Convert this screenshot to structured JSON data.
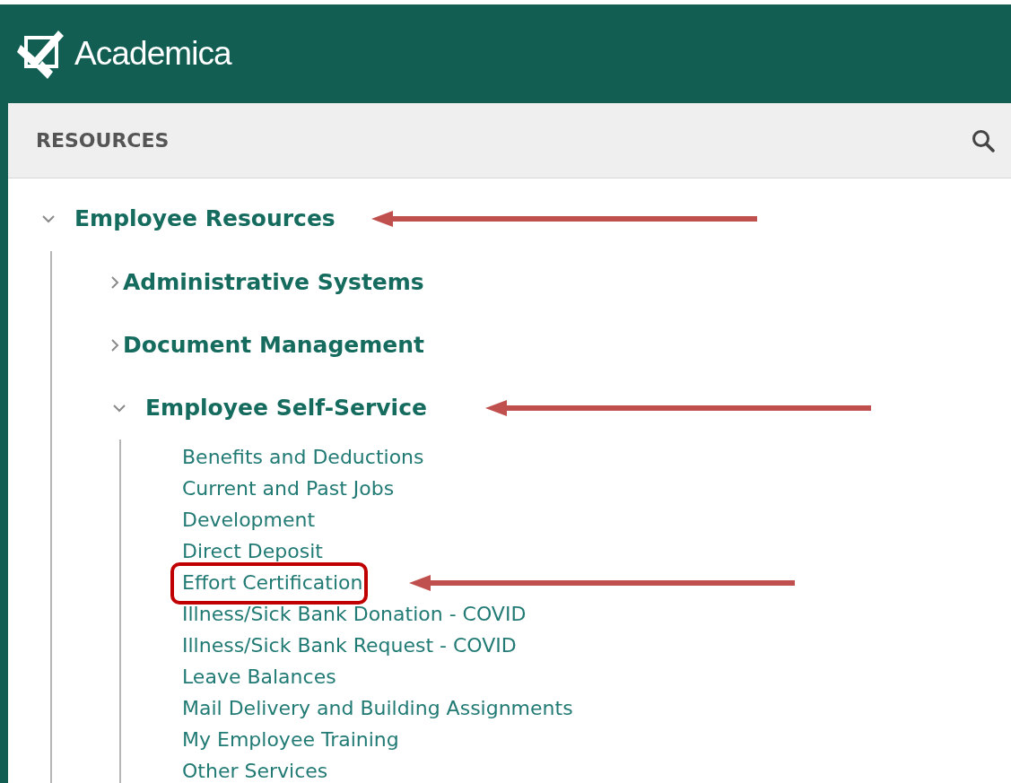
{
  "header": {
    "logo_text": "Academica"
  },
  "panel": {
    "title": "RESOURCES"
  },
  "tree": [
    {
      "label": "Employee Resources",
      "expanded": true,
      "arrow": true,
      "children": [
        {
          "label": "Administrative Systems",
          "expanded": false,
          "arrow": false
        },
        {
          "label": "Document Management",
          "expanded": false,
          "arrow": false
        },
        {
          "label": "Employee Self-Service",
          "expanded": true,
          "arrow": true,
          "children": [
            {
              "label": "Benefits and Deductions",
              "arrow": false,
              "boxed": false
            },
            {
              "label": "Current and Past Jobs",
              "arrow": false,
              "boxed": false
            },
            {
              "label": "Development",
              "arrow": false,
              "boxed": false
            },
            {
              "label": "Direct Deposit",
              "arrow": false,
              "boxed": false
            },
            {
              "label": "Effort Certification",
              "arrow": true,
              "boxed": true
            },
            {
              "label": "Illness/Sick Bank Donation - COVID",
              "arrow": false,
              "boxed": false
            },
            {
              "label": "Illness/Sick Bank Request - COVID",
              "arrow": false,
              "boxed": false
            },
            {
              "label": "Leave Balances",
              "arrow": false,
              "boxed": false
            },
            {
              "label": "Mail Delivery and Building Assignments",
              "arrow": false,
              "boxed": false
            },
            {
              "label": "My Employee Training",
              "arrow": false,
              "boxed": false
            },
            {
              "label": "Other Services",
              "arrow": false,
              "boxed": false
            }
          ]
        }
      ]
    }
  ]
}
